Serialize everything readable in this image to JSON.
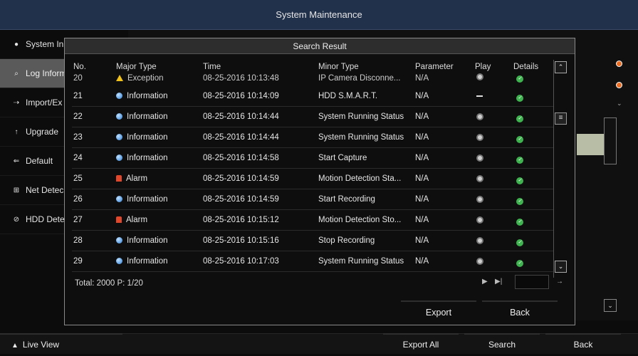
{
  "window": {
    "title": "System Maintenance"
  },
  "sidebar": {
    "items": [
      {
        "label": "System In",
        "icon": "info-icon"
      },
      {
        "label": "Log Inform",
        "icon": "search-icon"
      },
      {
        "label": "Import/Ex",
        "icon": "import-icon"
      },
      {
        "label": "Upgrade",
        "icon": "upgrade-icon"
      },
      {
        "label": "Default",
        "icon": "default-icon"
      },
      {
        "label": "Net Detec",
        "icon": "network-icon"
      },
      {
        "label": "HDD Dete",
        "icon": "hdd-icon"
      }
    ]
  },
  "dialog": {
    "title": "Search Result",
    "columns": [
      "No.",
      "Major Type",
      "Time",
      "Minor Type",
      "Parameter",
      "Play",
      "Details"
    ],
    "partial_row": {
      "no": "20",
      "major": "Exception",
      "major_icon": "exception",
      "time": "08-25-2016 10:13:48",
      "minor": "IP Camera Disconne...",
      "param": "N/A"
    },
    "rows": [
      {
        "no": "21",
        "major": "Information",
        "major_icon": "info",
        "time": "08-25-2016 10:14:09",
        "minor": "HDD S.M.A.R.T.",
        "param": "N/A",
        "play": "dash"
      },
      {
        "no": "22",
        "major": "Information",
        "major_icon": "info",
        "time": "08-25-2016 10:14:44",
        "minor": "System Running Status",
        "param": "N/A",
        "play": "play"
      },
      {
        "no": "23",
        "major": "Information",
        "major_icon": "info",
        "time": "08-25-2016 10:14:44",
        "minor": "System Running Status",
        "param": "N/A",
        "play": "play"
      },
      {
        "no": "24",
        "major": "Information",
        "major_icon": "info",
        "time": "08-25-2016 10:14:58",
        "minor": "Start Capture",
        "param": "N/A",
        "play": "play"
      },
      {
        "no": "25",
        "major": "Alarm",
        "major_icon": "alarm",
        "time": "08-25-2016 10:14:59",
        "minor": "Motion Detection Sta...",
        "param": "N/A",
        "play": "play"
      },
      {
        "no": "26",
        "major": "Information",
        "major_icon": "info",
        "time": "08-25-2016 10:14:59",
        "minor": "Start Recording",
        "param": "N/A",
        "play": "play"
      },
      {
        "no": "27",
        "major": "Alarm",
        "major_icon": "alarm",
        "time": "08-25-2016 10:15:12",
        "minor": "Motion Detection Sto...",
        "param": "N/A",
        "play": "play"
      },
      {
        "no": "28",
        "major": "Information",
        "major_icon": "info",
        "time": "08-25-2016 10:15:16",
        "minor": "Stop Recording",
        "param": "N/A",
        "play": "play"
      },
      {
        "no": "29",
        "major": "Information",
        "major_icon": "info",
        "time": "08-25-2016 10:17:03",
        "minor": "System Running Status",
        "param": "N/A",
        "play": "play"
      }
    ],
    "footer": {
      "total": "Total: 2000  P: 1/20"
    },
    "buttons": {
      "export": "Export",
      "back": "Back"
    }
  },
  "bottom": {
    "live_view": "Live View",
    "export_all": "Export All",
    "search": "Search",
    "back": "Back"
  },
  "colors": {
    "titlebar": "#21314b",
    "info": "#2e7ed6",
    "alarm": "#e0472b",
    "exception": "#f1c21b",
    "ok": "#3fb34f"
  }
}
